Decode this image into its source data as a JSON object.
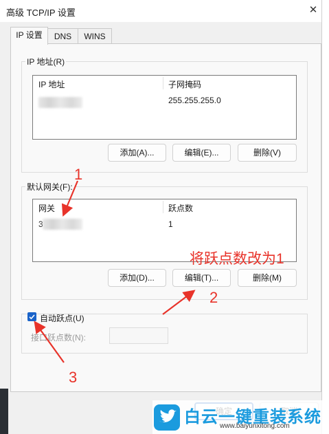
{
  "window": {
    "title": "高级 TCP/IP 设置",
    "close_glyph": "✕"
  },
  "tabs": [
    {
      "label": "IP 设置",
      "active": true
    },
    {
      "label": "DNS",
      "active": false
    },
    {
      "label": "WINS",
      "active": false
    }
  ],
  "ip_section": {
    "label": "IP 地址(R)",
    "columns": [
      "IP 地址",
      "子网掩码"
    ],
    "rows": [
      {
        "ip": "",
        "mask": "255.255.255.0"
      }
    ],
    "buttons": {
      "add": "添加(A)...",
      "edit": "编辑(E)...",
      "delete": "删除(V)"
    }
  },
  "gateway_section": {
    "label": "默认网关(F):",
    "columns": [
      "网关",
      "跃点数"
    ],
    "rows": [
      {
        "gateway": "3",
        "metric": "1"
      }
    ],
    "buttons": {
      "add": "添加(D)...",
      "edit": "编辑(T)...",
      "delete": "删除(M)"
    }
  },
  "auto_metric": {
    "checkbox_label": "自动跃点(U)",
    "checked": true,
    "interface_label": "接口跃点数(N):",
    "interface_value": ""
  },
  "footer": {
    "ok": "确定",
    "cancel": "取消"
  },
  "annotations": {
    "marker_1": "1",
    "marker_2": "2",
    "marker_3": "3",
    "instruction": "将跃点数改为1",
    "color": "#e8332a"
  },
  "watermark": {
    "title": "白云一键重装系统",
    "url": "www.baiyunxitong.com"
  },
  "colors": {
    "accent": "#1a63c9",
    "watermark": "#1b9bde"
  }
}
